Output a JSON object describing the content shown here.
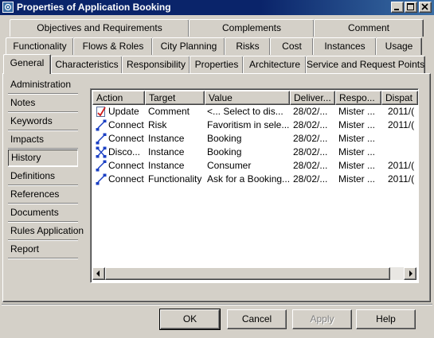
{
  "window": {
    "title": "Properties of Application Booking",
    "minimize_icon": "minimize-icon",
    "maximize_icon": "maximize-icon",
    "close_icon": "close-icon"
  },
  "tabs": {
    "row1": [
      "Objectives and Requirements",
      "Complements",
      "Comment"
    ],
    "row2": [
      "Functionality",
      "Flows & Roles",
      "City Planning",
      "Risks",
      "Cost",
      "Instances",
      "Usage"
    ],
    "row3": [
      "General",
      "Characteristics",
      "Responsibility",
      "Properties",
      "Architecture",
      "Service and Request Points"
    ],
    "active": "General"
  },
  "sidebar": {
    "items": [
      "Administration",
      "Notes",
      "Keywords",
      "Impacts",
      "History",
      "Definitions",
      "References",
      "Documents",
      "Rules Application",
      "Report"
    ],
    "active": "History"
  },
  "table": {
    "columns": [
      "Action",
      "Target",
      "Value",
      "Deliver...",
      "Respo...",
      "Dispat"
    ],
    "rows": [
      {
        "icon": "update-icon",
        "action": "Update",
        "target": "Comment",
        "value": "<... Select to dis...",
        "delivered": "28/02/...",
        "responsible": "Mister ...",
        "dispatched": "2011/("
      },
      {
        "icon": "connect-icon",
        "action": "Connect",
        "target": "Risk",
        "value": "Favoritism in sele...",
        "delivered": "28/02/...",
        "responsible": "Mister ...",
        "dispatched": "2011/("
      },
      {
        "icon": "connect-icon",
        "action": "Connect",
        "target": "Instance",
        "value": "Booking",
        "delivered": "28/02/...",
        "responsible": "Mister ...",
        "dispatched": ""
      },
      {
        "icon": "disconnect-icon",
        "action": "Disco...",
        "target": "Instance",
        "value": "Booking",
        "delivered": "28/02/...",
        "responsible": "Mister ...",
        "dispatched": ""
      },
      {
        "icon": "connect-icon",
        "action": "Connect",
        "target": "Instance",
        "value": "Consumer",
        "delivered": "28/02/...",
        "responsible": "Mister ...",
        "dispatched": "2011/("
      },
      {
        "icon": "connect-icon",
        "action": "Connect",
        "target": "Functionality",
        "value": "Ask for a Booking...",
        "delivered": "28/02/...",
        "responsible": "Mister ...",
        "dispatched": "2011/("
      }
    ]
  },
  "buttons": {
    "ok": "OK",
    "cancel": "Cancel",
    "apply": "Apply",
    "help": "Help"
  },
  "colors": {
    "title_bar": "#0a246a",
    "face": "#d4d0c8",
    "connect_icon": "#1a3fc4"
  }
}
